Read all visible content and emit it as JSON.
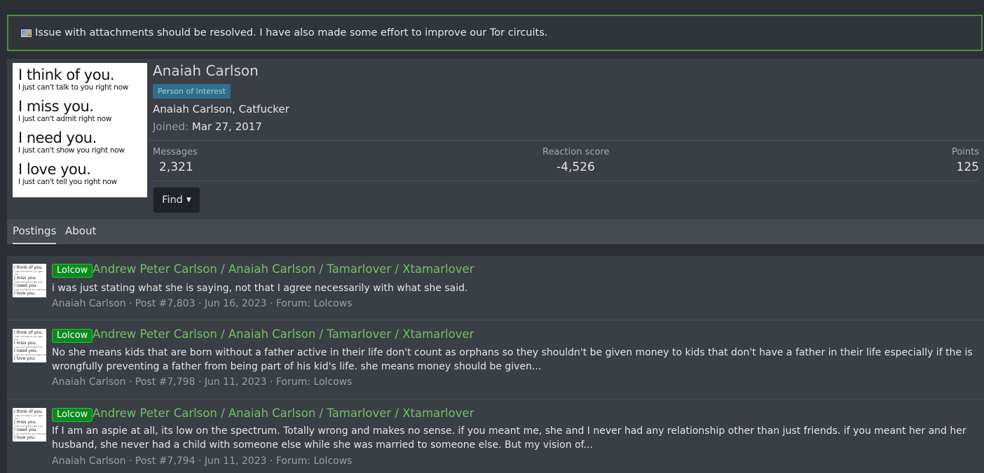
{
  "notice": {
    "text": "Issue with attachments should be resolved. I have also made some effort to improve our Tor circuits."
  },
  "profile": {
    "name": "Anaiah Carlson",
    "badge": "Person of Interest",
    "custom_title": "Anaiah Carlson, Catfucker",
    "joined_label": "Joined:",
    "joined_value": "Mar 27, 2017",
    "avatar_text": [
      {
        "big": "I think of you.",
        "small": "I just can't talk to you right now"
      },
      {
        "big": "I miss you.",
        "small": "I just can't admit right now"
      },
      {
        "big": "I need you.",
        "small": "I just can't show you right now"
      },
      {
        "big": "I love you.",
        "small": "I just can't tell you right now"
      }
    ],
    "stats": {
      "messages_label": "Messages",
      "messages_value": "2,321",
      "reaction_label": "Reaction score",
      "reaction_value": "-4,526",
      "points_label": "Points",
      "points_value": "125"
    },
    "find_label": "Find",
    "tabs": [
      {
        "label": "Postings"
      },
      {
        "label": "About"
      }
    ]
  },
  "posts": [
    {
      "prefix": "Lolcow",
      "title": "Andrew Peter Carlson / Anaiah Carlson / Tamarlover / Xtamarlover",
      "snippet": "i was just stating what she is saying, not that I agree necessarily with what she said.",
      "author": "Anaiah Carlson",
      "post_no": "Post #7,803",
      "date": "Jun 16, 2023",
      "forum_label": "Forum:",
      "forum": "Lolcows"
    },
    {
      "prefix": "Lolcow",
      "title": "Andrew Peter Carlson / Anaiah Carlson / Tamarlover / Xtamarlover",
      "snippet": "No she means kids that are born without a father active in their life don't count as orphans so they shouldn't be given money to kids that don't have a father in their life especially if the is wrongfully preventing a father from being part of his kid's life. she means money should be given...",
      "author": "Anaiah Carlson",
      "post_no": "Post #7,798",
      "date": "Jun 11, 2023",
      "forum_label": "Forum:",
      "forum": "Lolcows"
    },
    {
      "prefix": "Lolcow",
      "title": "Andrew Peter Carlson / Anaiah Carlson / Tamarlover / Xtamarlover",
      "snippet": "If I am an aspie at all, its low on the spectrum. Totally wrong and makes no sense. if you meant me, she and I never had any relationship other than just friends. if you meant her and her husband, she never had a child with someone else while she was married to someone else. But my vision of...",
      "author": "Anaiah Carlson",
      "post_no": "Post #7,794",
      "date": "Jun 11, 2023",
      "forum_label": "Forum:",
      "forum": "Lolcows"
    }
  ]
}
